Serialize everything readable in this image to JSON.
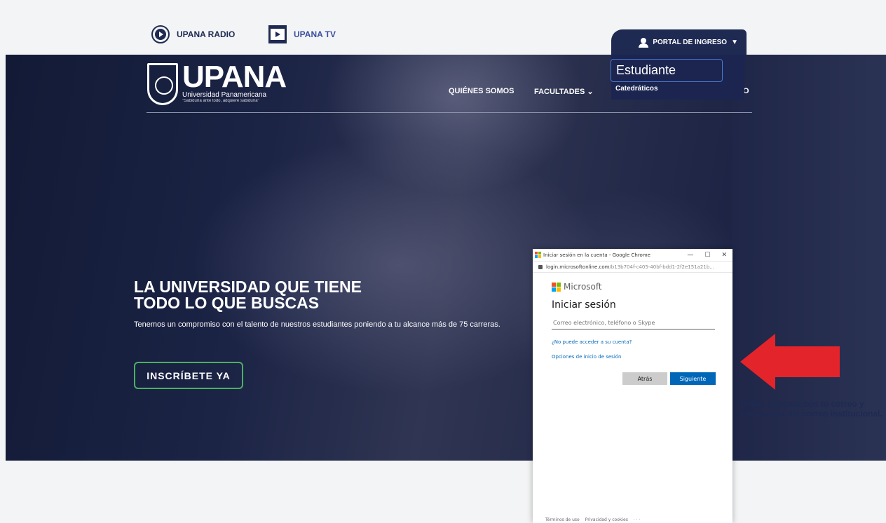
{
  "topbar": {
    "radio_label": "UPANA RADIO",
    "tv_label": "UPANA TV",
    "portal_label": "PORTAL DE INGRESO",
    "portal_caret": "▼"
  },
  "header": {
    "logo_title": "UPANA",
    "logo_subtitle": "Universidad Panamericana",
    "logo_motto": "\"Sabiduría ante todo, adquiere sabiduría\"",
    "nav": {
      "quienes": "QUIÉNES SOMOS",
      "facultades": "FACULTADES ⌄",
      "extra": "O"
    }
  },
  "portal_menu": {
    "student": "Estudiante",
    "teachers": "Catedráticos"
  },
  "hero": {
    "title_line1": "LA UNIVERSIDAD QUE TIENE",
    "title_line2": "TODO LO QUE BUSCAS",
    "subtitle": "Tenemos un compromiso con el talento de nuestros estudiantes poniendo a tu alcance más de 75 carreras.",
    "cta": "INSCRÍBETE YA"
  },
  "login_popup": {
    "window_title": "Iniciar sesión en la cuenta - Google Chrome",
    "min": "—",
    "max": "☐",
    "close": "✕",
    "url_domain": "login.microsoftonline.com",
    "url_rest": "/b13b704f-c405-40bf-bdd1-2f2e151a21b...",
    "brand": "Microsoft",
    "heading": "Iniciar sesión",
    "email_placeholder": "Correo electrónico, teléfono o Skype",
    "cant_access": "¿No puede acceder a su cuenta?",
    "signin_options": "Opciones de inicio de sesión",
    "back": "Atrás",
    "next": "Siguiente",
    "terms": "Términos de uso",
    "privacy": "Privacidad y cookies",
    "more": "· · ·"
  },
  "annotation": {
    "note": "Debes ingresar con tu correo y contraseña del correo institucional.",
    "arrow_color": "#e3242b"
  },
  "colors": {
    "navy": "#1e2a52",
    "cta_border": "#4caf63",
    "ms_blue": "#0067b8"
  }
}
